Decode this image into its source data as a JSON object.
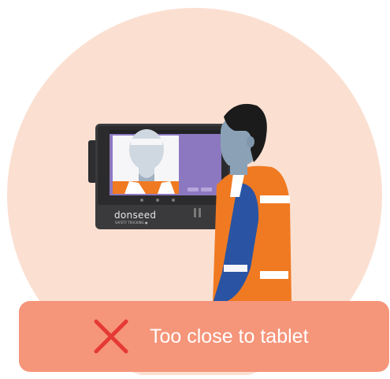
{
  "colors": {
    "circle": "#fbe0d2",
    "banner": "#f5957a",
    "x_mark": "#e53935",
    "vest": "#f07a22",
    "stripe": "#ffffff",
    "skin": "#8aa1b6",
    "hair": "#1b1b1b",
    "shirt": "#2a54a3",
    "tablet": "#3a3a3c",
    "screen": "#8c78c0"
  },
  "device": {
    "brand": "donseed",
    "brand_sub": "SAFETY TRACKING ●"
  },
  "banner": {
    "icon": "close-icon",
    "message": "Too close to tablet"
  }
}
